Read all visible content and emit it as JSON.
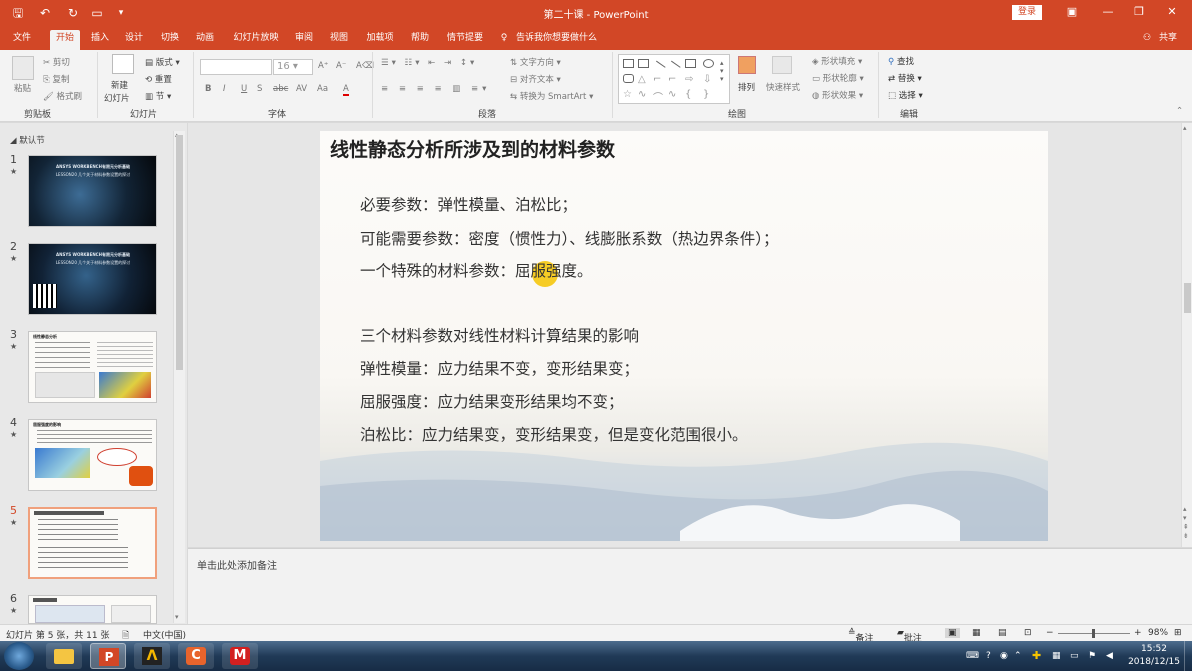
{
  "window": {
    "title": "第二十课 - PowerPoint",
    "login_label": "登录"
  },
  "tabs": [
    {
      "label": "文件"
    },
    {
      "label": "开始"
    },
    {
      "label": "插入"
    },
    {
      "label": "设计"
    },
    {
      "label": "切换"
    },
    {
      "label": "动画"
    },
    {
      "label": "幻灯片放映"
    },
    {
      "label": "审阅"
    },
    {
      "label": "视图"
    },
    {
      "label": "加载项"
    },
    {
      "label": "帮助"
    },
    {
      "label": "情节提要"
    }
  ],
  "tell_me": "告诉我你想要做什么",
  "share": "共享",
  "ribbon": {
    "clipboard": {
      "cut": "剪切",
      "copy": "复制",
      "format_painter": "格式刷",
      "paste": "粘贴",
      "group": "剪贴板"
    },
    "slides": {
      "new_slide": "新建",
      "new_slide2": "幻灯片",
      "layout": "版式",
      "reset": "重置",
      "section": "节",
      "group": "幻灯片"
    },
    "font": {
      "font_name": "",
      "font_size": "16",
      "group": "字体",
      "buttons": [
        "B",
        "I",
        "U",
        "S",
        "abc",
        "AV",
        "Aa",
        "A"
      ]
    },
    "paragraph": {
      "text_direction": "文字方向",
      "align_text": "对齐文本",
      "convert_smartart": "转换为 SmartArt",
      "group": "段落"
    },
    "drawing": {
      "arrange": "排列",
      "quick_styles": "快速样式",
      "shape_fill": "形状填充",
      "shape_outline": "形状轮廓",
      "shape_effects": "形状效果",
      "group": "绘图"
    },
    "editing": {
      "find": "查找",
      "replace": "替换",
      "select": "选择",
      "group": "编辑"
    }
  },
  "section_label": "默认节",
  "thumbnails": [
    {
      "num": "1",
      "star": "★"
    },
    {
      "num": "2",
      "star": "★"
    },
    {
      "num": "3",
      "star": "★"
    },
    {
      "num": "4",
      "star": "★"
    },
    {
      "num": "5",
      "star": "★"
    },
    {
      "num": "6",
      "star": "★"
    }
  ],
  "thumb_text": {
    "t1_line1": "ANSYS WORKBENCH有限元分析基础",
    "t1_line2": "LESSON20 几个关于材料参数设置的探讨",
    "t2_line1": "ANSYS WORKBENCH有限元分析基础",
    "t2_line2": "LESSON20 几个关于材料参数设置的探讨",
    "t3_title": "线性静态分析",
    "t4_title": "屈服强度的影响"
  },
  "slide": {
    "title": "线性静态分析所涉及到的材料参数",
    "lines": [
      "必要参数：弹性模量、泊松比；",
      "可能需要参数：密度（惯性力）、线膨胀系数（热边界条件）；",
      "一个特殊的材料参数：屈服强度。",
      "三个材料参数对线性材料计算结果的影响",
      "弹性模量：应力结果不变，变形结果变；",
      "屈服强度：应力结果变形结果均不变；",
      "泊松比：应力结果变，变形结果变，但是变化范围很小。"
    ]
  },
  "notes_placeholder": "单击此处添加备注",
  "status": {
    "slide_info": "幻灯片 第 5 张，共 11 张",
    "language": "中文(中国)",
    "notes": "备注",
    "comments": "批注",
    "zoom": "98%"
  },
  "taskbar": {
    "time": "15:52",
    "date": "2018/12/15"
  },
  "colors": {
    "accent": "#d24726",
    "selected_thumb": "#f0a07c"
  }
}
